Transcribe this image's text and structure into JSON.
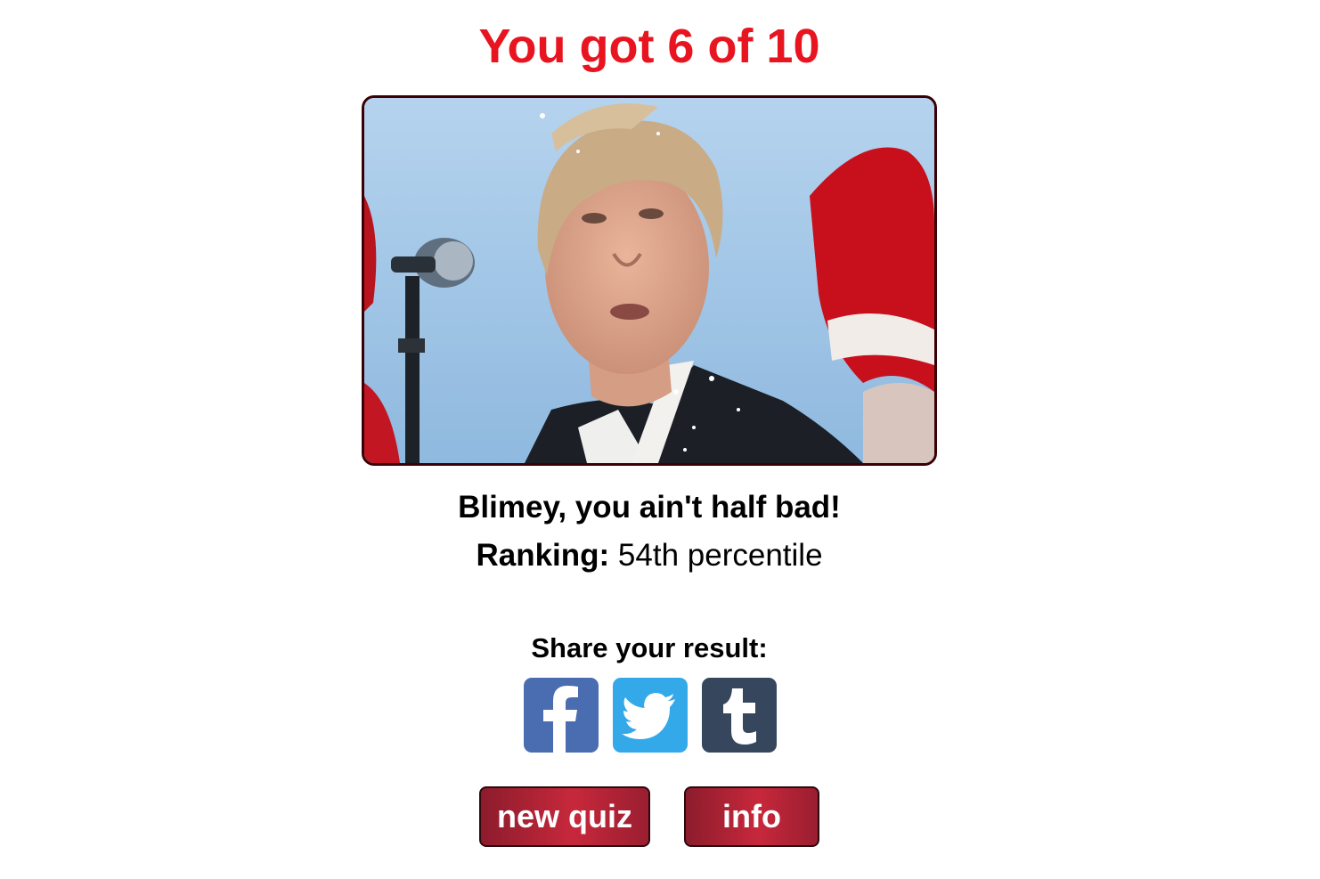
{
  "result": {
    "title": "You got 6 of 10",
    "verdict": "Blimey, you ain't half bad!",
    "ranking_label": "Ranking:",
    "ranking_value": " 54th percentile",
    "score_correct": 6,
    "score_total": 10
  },
  "share": {
    "label": "Share your result:",
    "buttons": [
      {
        "name": "facebook",
        "icon": "facebook-icon",
        "color": "#4a6cb0"
      },
      {
        "name": "twitter",
        "icon": "twitter-icon",
        "color": "#33a9ea"
      },
      {
        "name": "tumblr",
        "icon": "tumblr-icon",
        "color": "#36465d"
      }
    ]
  },
  "actions": {
    "new_quiz_label": "new quiz",
    "info_label": "info"
  },
  "colors": {
    "title": "#e8141f",
    "button_accent": "#c7283b",
    "button_dark": "#8c1c2c"
  }
}
